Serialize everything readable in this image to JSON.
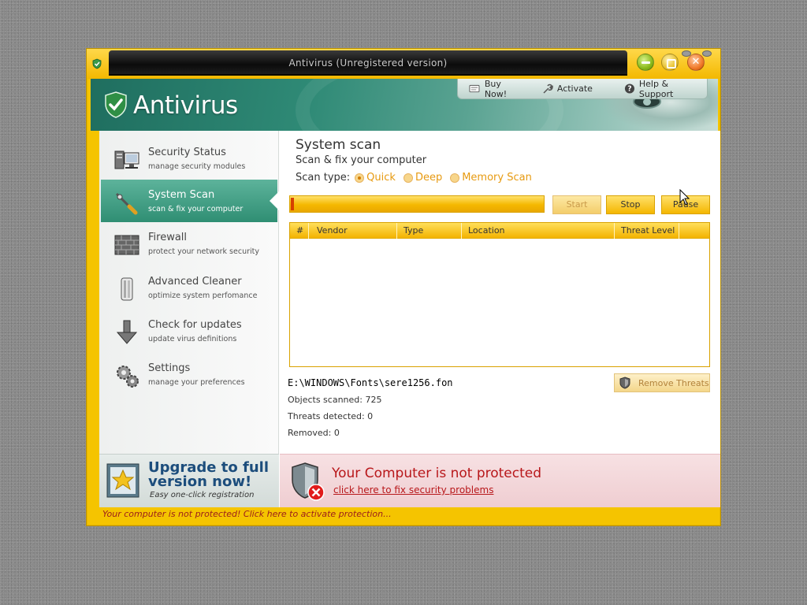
{
  "window": {
    "title": "Antivirus (Unregistered version)"
  },
  "brand": {
    "name": "Antivirus"
  },
  "top_links": [
    {
      "label": "Buy Now!",
      "icon": "cart-icon"
    },
    {
      "label": "Activate",
      "icon": "wrench-icon"
    },
    {
      "label": "Help & Support",
      "icon": "help-icon"
    }
  ],
  "sidebar": {
    "items": [
      {
        "title": "Security Status",
        "subtitle": "manage security modules",
        "icon": "computer-icon",
        "active": false
      },
      {
        "title": "System Scan",
        "subtitle": "scan & fix your computer",
        "icon": "scan-tool-icon",
        "active": true
      },
      {
        "title": "Firewall",
        "subtitle": "protect your network security",
        "icon": "brick-wall-icon",
        "active": false
      },
      {
        "title": "Advanced Cleaner",
        "subtitle": "optimize system perfomance",
        "icon": "cleaner-icon",
        "active": false
      },
      {
        "title": "Check for updates",
        "subtitle": "update virus definitions",
        "icon": "download-arrow-icon",
        "active": false
      },
      {
        "title": "Settings",
        "subtitle": "manage your preferences",
        "icon": "gears-icon",
        "active": false
      }
    ],
    "upgrade": {
      "title": "Upgrade to full version now!",
      "subtitle": "Easy one-click registration"
    }
  },
  "main": {
    "title": "System scan",
    "subtitle": "Scan & fix your computer",
    "scan_type_label": "Scan type:",
    "scan_types": [
      {
        "label": "Quick",
        "selected": true
      },
      {
        "label": "Deep",
        "selected": false
      },
      {
        "label": "Memory Scan",
        "selected": false
      }
    ],
    "progress_fraction": 0.01,
    "buttons": {
      "start": "Start",
      "stop": "Stop",
      "pause": "Pause",
      "remove": "Remove Threats"
    },
    "table": {
      "columns": [
        "#",
        "Vendor",
        "Type",
        "Location",
        "Threat Level"
      ],
      "rows": []
    },
    "current_file": "E:\\WINDOWS\\Fonts\\sere1256.fon",
    "stats": {
      "scanned": "Objects scanned: 725",
      "detected": "Threats detected: 0",
      "removed": "Removed: 0"
    }
  },
  "alert": {
    "title": "Your Computer is not protected",
    "link": "click here to fix security problems"
  },
  "status_bar": {
    "text": "Your computer is not protected! Click here to activate protection..."
  },
  "colors": {
    "window_frame": "#f5c400",
    "accent_green": "#2f8e73",
    "alert_red": "#b8171a",
    "button_yellow": "#f4b600"
  }
}
